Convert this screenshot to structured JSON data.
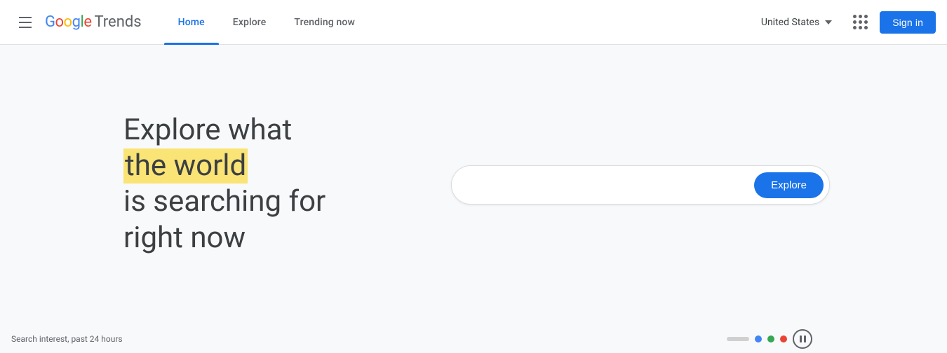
{
  "header": {
    "menu_label": "menu",
    "logo": {
      "google": "Google",
      "trends": "Trends"
    },
    "nav": [
      {
        "label": "Home",
        "active": true
      },
      {
        "label": "Explore",
        "active": false
      },
      {
        "label": "Trending now",
        "active": false
      }
    ],
    "country": "United States",
    "apps_icon_label": "Google apps",
    "sign_in_label": "Sign in"
  },
  "hero": {
    "line1": "Explore what",
    "highlight": "the world",
    "line3": "is searching for",
    "line4": "right now"
  },
  "search": {
    "placeholder": "",
    "explore_label": "Explore"
  },
  "footer": {
    "text": "Search interest, past 24 hours"
  },
  "indicators": {
    "dots": [
      {
        "color": "#ea4335"
      },
      {
        "color": "#4285f4"
      },
      {
        "color": "#34a853"
      },
      {
        "color": "#ea4335"
      }
    ]
  }
}
